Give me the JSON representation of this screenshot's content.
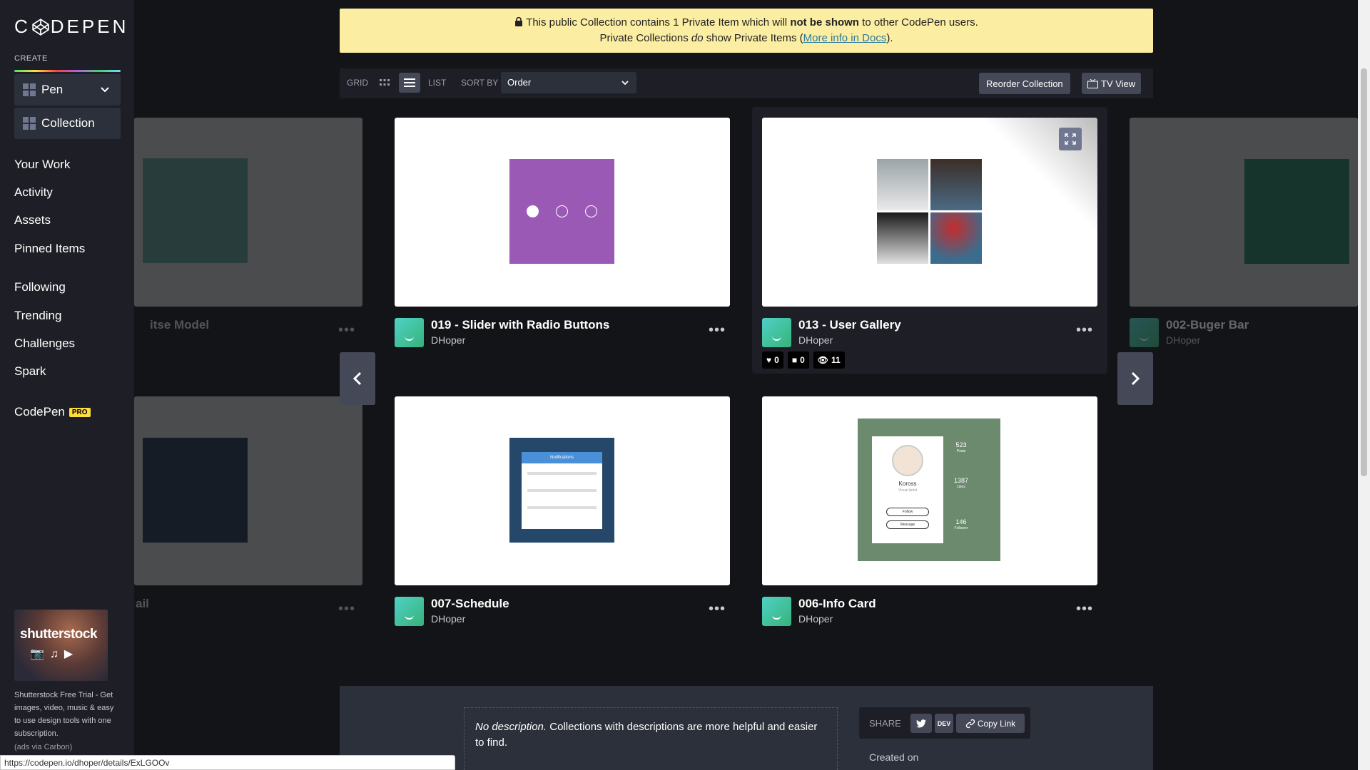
{
  "brand": {
    "logo_text": "CODEPEN"
  },
  "sidebar": {
    "create_label": "CREATE",
    "create_items": [
      {
        "label": "Pen"
      },
      {
        "label": "Collection"
      }
    ],
    "nav": [
      "Your Work",
      "Activity",
      "Assets",
      "Pinned Items",
      "Following",
      "Trending",
      "Challenges",
      "Spark",
      "CodePen"
    ],
    "pro_badge": "PRO",
    "ad": {
      "brand": "shutterstock",
      "text": "Shutterstock Free Trial - Get images, video, music & easy to use design tools with one subscription.",
      "via": "(ads via Carbon)"
    }
  },
  "banner": {
    "line1_pre": "This public Collection contains 1 Private Item which will ",
    "line1_bold": "not be shown",
    "line1_post": " to other CodePen users.",
    "line2_pre": "Private Collections ",
    "line2_em": "do",
    "line2_mid": " show Private Items (",
    "line2_link": "More info in Docs",
    "line2_post": ")."
  },
  "toolbar": {
    "grid_label": "GRID",
    "list_label": "LIST",
    "sort_label": "SORT BY",
    "sort_value": "Order",
    "reorder_label": "Reorder Collection",
    "tv_label": "TV View"
  },
  "cards": [
    {
      "title": "019 - Slider with Radio Buttons",
      "author": "DHoper"
    },
    {
      "title": "013 - User Gallery",
      "author": "DHoper",
      "stats": {
        "hearts": "0",
        "comments": "0",
        "views": "11"
      }
    },
    {
      "title": "007-Schedule",
      "author": "DHoper"
    },
    {
      "title": "006-Info Card",
      "author": "DHoper"
    }
  ],
  "ghost_cards": [
    {
      "title": "itse Model"
    },
    {
      "title": "002-Buger Bar",
      "author": "DHoper"
    },
    {
      "title": "ail"
    }
  ],
  "info_card_preview": {
    "name": "Koross",
    "role": "Visual Artist",
    "stats": [
      "523",
      "1387",
      "146"
    ],
    "stat_labels": [
      "Posts",
      "Likes",
      "Follower"
    ],
    "follow": "Follow",
    "message": "Message"
  },
  "schedule_preview": {
    "title": "Notifications"
  },
  "bottom": {
    "desc_em": "No description.",
    "desc_rest": " Collections with descriptions are more helpful and easier to find.",
    "share_label": "SHARE",
    "dev_label": "DEV",
    "copy_link": "Copy Link",
    "created_on": "Created on"
  },
  "statusbar": {
    "url": "https://codepen.io/dhoper/details/ExLGOOv"
  },
  "colors": {
    "accent_yellow": "#ffdd40",
    "banner_bg": "#fbeea2",
    "card_purple": "#9b59b6",
    "bg": "#131417"
  }
}
